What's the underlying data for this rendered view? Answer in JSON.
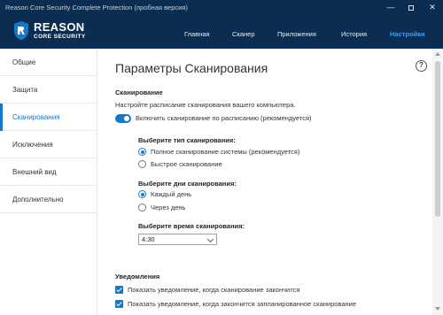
{
  "window": {
    "title": "Reason Core Security Complete Protection (пробная версия)",
    "minimize": "—",
    "close": "✕"
  },
  "logo": {
    "name": "REASON",
    "subtitle": "CORE SECURITY",
    "icon": "shield-r-icon"
  },
  "topnav": [
    "Главная",
    "Сканер",
    "Приложения",
    "История",
    "Настройки"
  ],
  "active_topnav": "Настройки",
  "sidebar": {
    "items": [
      {
        "label": "Общие"
      },
      {
        "label": "Защита"
      },
      {
        "label": "Сканирования"
      },
      {
        "label": "Исключения"
      },
      {
        "label": "Внешний вид"
      },
      {
        "label": "Дополнительно"
      }
    ],
    "active": "Сканирования"
  },
  "main": {
    "title": "Параметры Сканирования",
    "help": "?",
    "scan": {
      "section_title": "Сканирование",
      "description": "Настройте расписание сканирования вашего компьютера.",
      "schedule_toggle": {
        "label": "Включить сканирование по расписанию (рекомендуется)",
        "on": true
      },
      "type": {
        "title": "Выберите тип сканирования:",
        "options": [
          "Полное сканирование системы (рекомендуется)",
          "Быстрое сканирование"
        ],
        "selected": "Полное сканирование системы (рекомендуется)"
      },
      "days": {
        "title": "Выберите дни сканирования:",
        "options": [
          "Каждый день",
          "Через день"
        ],
        "selected": "Каждый день"
      },
      "time": {
        "title": "Выберите время сканирования:",
        "value": "4:30"
      }
    },
    "notifications": {
      "section_title": "Уведомления",
      "items": [
        {
          "label": "Показать уведомление, когда сканирование закончится",
          "checked": true
        },
        {
          "label": "Показать уведомление, когда закончится запланированное сканирование",
          "checked": true
        }
      ]
    }
  },
  "colors": {
    "header_bg": "#0c2d52",
    "accent": "#1479c8",
    "active_nav": "#3aa0f0"
  }
}
